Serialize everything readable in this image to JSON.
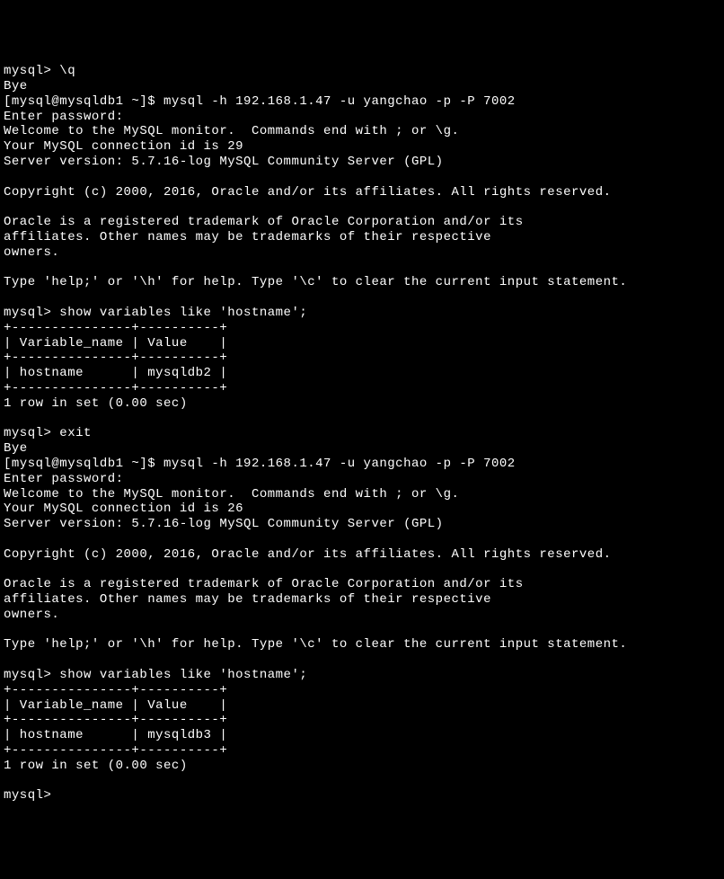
{
  "lines": [
    "mysql> \\q",
    "Bye",
    "[mysql@mysqldb1 ~]$ mysql -h 192.168.1.47 -u yangchao -p -P 7002",
    "Enter password:",
    "Welcome to the MySQL monitor.  Commands end with ; or \\g.",
    "Your MySQL connection id is 29",
    "Server version: 5.7.16-log MySQL Community Server (GPL)",
    "",
    "Copyright (c) 2000, 2016, Oracle and/or its affiliates. All rights reserved.",
    "",
    "Oracle is a registered trademark of Oracle Corporation and/or its",
    "affiliates. Other names may be trademarks of their respective",
    "owners.",
    "",
    "Type 'help;' or '\\h' for help. Type '\\c' to clear the current input statement.",
    "",
    "mysql> show variables like 'hostname';",
    "+---------------+----------+",
    "| Variable_name | Value    |",
    "+---------------+----------+",
    "| hostname      | mysqldb2 |",
    "+---------------+----------+",
    "1 row in set (0.00 sec)",
    "",
    "mysql> exit",
    "Bye",
    "[mysql@mysqldb1 ~]$ mysql -h 192.168.1.47 -u yangchao -p -P 7002",
    "Enter password:",
    "Welcome to the MySQL monitor.  Commands end with ; or \\g.",
    "Your MySQL connection id is 26",
    "Server version: 5.7.16-log MySQL Community Server (GPL)",
    "",
    "Copyright (c) 2000, 2016, Oracle and/or its affiliates. All rights reserved.",
    "",
    "Oracle is a registered trademark of Oracle Corporation and/or its",
    "affiliates. Other names may be trademarks of their respective",
    "owners.",
    "",
    "Type 'help;' or '\\h' for help. Type '\\c' to clear the current input statement.",
    "",
    "mysql> show variables like 'hostname';",
    "+---------------+----------+",
    "| Variable_name | Value    |",
    "+---------------+----------+",
    "| hostname      | mysqldb3 |",
    "+---------------+----------+",
    "1 row in set (0.00 sec)",
    "",
    "mysql>"
  ]
}
